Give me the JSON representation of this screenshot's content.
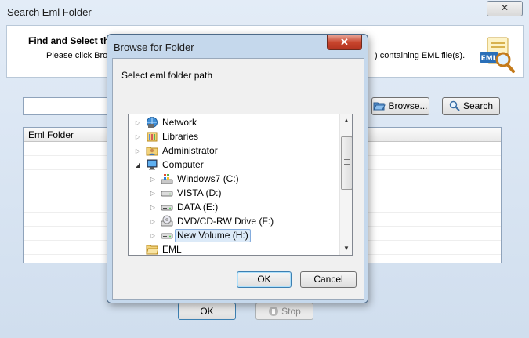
{
  "background_window": {
    "title": "Search Eml Folder",
    "close_label": "✕",
    "header": {
      "heading": "Find and Select th",
      "instruction": "Please click Bro",
      "instruction_tail": ") containing EML file(s)."
    },
    "logo_text": "EML",
    "path_value": "",
    "browse_label": "Browse...",
    "search_label": "Search",
    "grid": {
      "columns": [
        "Eml Folder"
      ],
      "rows": []
    },
    "ok_label": "OK",
    "stop_label": "Stop"
  },
  "dialog": {
    "title": "Browse for Folder",
    "close_label": "✕",
    "prompt": "Select eml folder path",
    "tree": [
      {
        "label": "Network",
        "icon": "network-icon",
        "expander": "▷"
      },
      {
        "label": "Libraries",
        "icon": "libraries-icon",
        "expander": "▷"
      },
      {
        "label": "Administrator",
        "icon": "user-folder-icon",
        "expander": "▷"
      },
      {
        "label": "Computer",
        "icon": "computer-icon",
        "expander": "◢"
      },
      {
        "label": "Windows7  (C:)",
        "icon": "system-drive-icon",
        "expander": "▷"
      },
      {
        "label": "VISTA (D:)",
        "icon": "hard-drive-icon",
        "expander": "▷"
      },
      {
        "label": "DATA (E:)",
        "icon": "hard-drive-icon",
        "expander": "▷"
      },
      {
        "label": "DVD/CD-RW Drive (F:)",
        "icon": "dvd-drive-icon",
        "expander": "▷"
      },
      {
        "label": "New Volume (H:)",
        "icon": "hard-drive-icon",
        "expander": "▷",
        "selected": true
      },
      {
        "label": "EML",
        "icon": "folder-icon",
        "expander": ""
      }
    ],
    "ok_label": "OK",
    "cancel_label": "Cancel"
  },
  "colors": {
    "accent": "#3c7fb1",
    "close_red": "#c8452d",
    "selection": "#dceaf8"
  }
}
